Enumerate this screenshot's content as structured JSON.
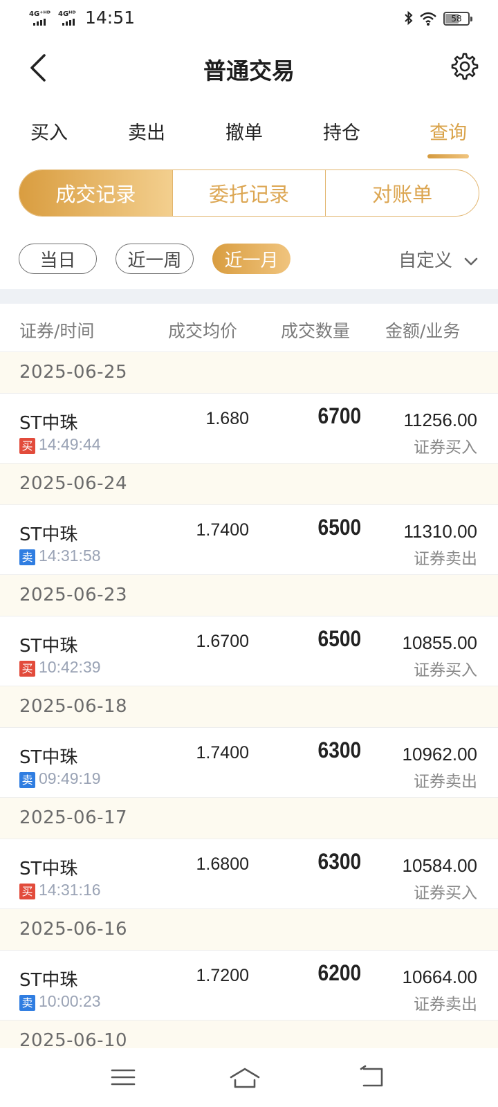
{
  "status_bar": {
    "signal1": "4G⁺ᴴᴰ",
    "signal2": "4Gᴴᴰ",
    "time": "14:51",
    "battery": "58"
  },
  "header": {
    "title": "普通交易",
    "back_icon": "chevron-left-icon",
    "settings_icon": "gear-icon"
  },
  "tabs": [
    {
      "label": "买入"
    },
    {
      "label": "卖出"
    },
    {
      "label": "撤单"
    },
    {
      "label": "持仓"
    },
    {
      "label": "查询",
      "active": true
    }
  ],
  "segments": [
    {
      "label": "成交记录",
      "active": true
    },
    {
      "label": "委托记录"
    },
    {
      "label": "对账单"
    }
  ],
  "periods": [
    {
      "label": "当日"
    },
    {
      "label": "近一周"
    },
    {
      "label": "近一月",
      "active": true
    }
  ],
  "custom_label": "自定义",
  "columns": [
    "证券/时间",
    "成交均价",
    "成交数量",
    "金额/业务"
  ],
  "records": [
    {
      "date": "2025-06-25",
      "name": "ST中珠",
      "side": "买",
      "type": "buy",
      "time": "14:49:44",
      "price": "1.680",
      "qty": "6700",
      "amount": "11256.00",
      "business": "证券买入"
    },
    {
      "date": "2025-06-24",
      "name": "ST中珠",
      "side": "卖",
      "type": "sell",
      "time": "14:31:58",
      "price": "1.7400",
      "qty": "6500",
      "amount": "11310.00",
      "business": "证券卖出"
    },
    {
      "date": "2025-06-23",
      "name": "ST中珠",
      "side": "买",
      "type": "buy",
      "time": "10:42:39",
      "price": "1.6700",
      "qty": "6500",
      "amount": "10855.00",
      "business": "证券买入"
    },
    {
      "date": "2025-06-18",
      "name": "ST中珠",
      "side": "卖",
      "type": "sell",
      "time": "09:49:19",
      "price": "1.7400",
      "qty": "6300",
      "amount": "10962.00",
      "business": "证券卖出"
    },
    {
      "date": "2025-06-17",
      "name": "ST中珠",
      "side": "买",
      "type": "buy",
      "time": "14:31:16",
      "price": "1.6800",
      "qty": "6300",
      "amount": "10584.00",
      "business": "证券买入"
    },
    {
      "date": "2025-06-16",
      "name": "ST中珠",
      "side": "卖",
      "type": "sell",
      "time": "10:00:23",
      "price": "1.7200",
      "qty": "6200",
      "amount": "10664.00",
      "business": "证券卖出"
    }
  ],
  "partial_date": "2025-06-10",
  "colors": {
    "accent": "#d9a248",
    "buy": "#e24b3b",
    "sell": "#2f7de1",
    "date_row_bg": "#fdfaf0"
  },
  "nav": {
    "menu_icon": "menu-icon",
    "home_icon": "home-icon",
    "back_icon": "back-icon"
  }
}
